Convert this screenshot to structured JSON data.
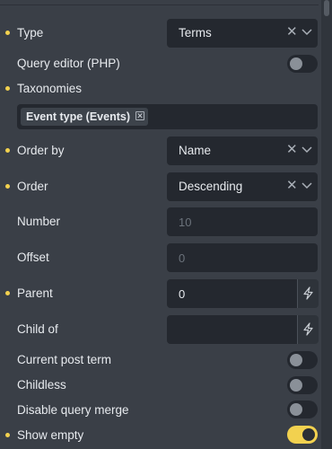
{
  "colors": {
    "background": "#3a3f47",
    "field": "#24282f",
    "accent": "#f2d14f",
    "text": "#e7eaee",
    "placeholder": "#6b727b"
  },
  "type": {
    "label": "Type",
    "value": "Terms"
  },
  "query_editor": {
    "label": "Query editor (PHP)",
    "enabled": false
  },
  "taxonomies": {
    "label": "Taxonomies",
    "tags": [
      "Event type (Events)"
    ]
  },
  "order_by": {
    "label": "Order by",
    "value": "Name"
  },
  "order": {
    "label": "Order",
    "value": "Descending"
  },
  "number": {
    "label": "Number",
    "placeholder": "10"
  },
  "offset": {
    "label": "Offset",
    "placeholder": "0"
  },
  "parent": {
    "label": "Parent",
    "value": "0"
  },
  "child_of": {
    "label": "Child of",
    "value": ""
  },
  "current_post_term": {
    "label": "Current post term",
    "enabled": false
  },
  "childless": {
    "label": "Childless",
    "enabled": false
  },
  "disable_query_merge": {
    "label": "Disable query merge",
    "enabled": false
  },
  "show_empty": {
    "label": "Show empty",
    "enabled": true
  },
  "icons": {
    "clear": "close-icon",
    "dropdown": "chevron-down-icon",
    "dynamic_data": "bolt-icon"
  }
}
